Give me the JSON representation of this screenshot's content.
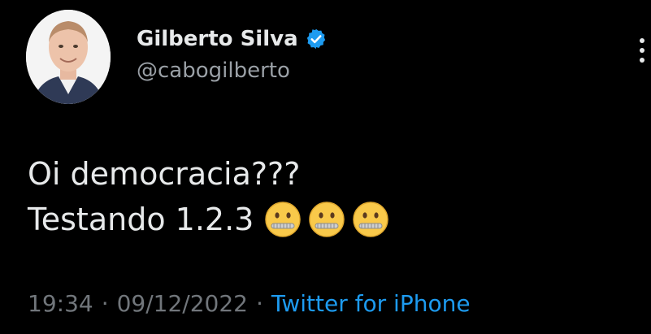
{
  "author": {
    "display_name": "Gilberto Silva",
    "handle": "@cabogilberto",
    "verified": true,
    "verified_color": "#1d9bf0"
  },
  "tweet": {
    "line1": "Oi democracia???",
    "line2": "Testando 1.2.3",
    "emojis": [
      "zipper-mouth-face",
      "zipper-mouth-face",
      "zipper-mouth-face"
    ]
  },
  "meta": {
    "time": "19:34",
    "separator": "·",
    "date": "09/12/2022",
    "source": "Twitter for iPhone",
    "source_color": "#1d9bf0"
  },
  "colors": {
    "background": "#000000",
    "text_primary": "#e7e9ea",
    "text_secondary": "#71767b"
  }
}
